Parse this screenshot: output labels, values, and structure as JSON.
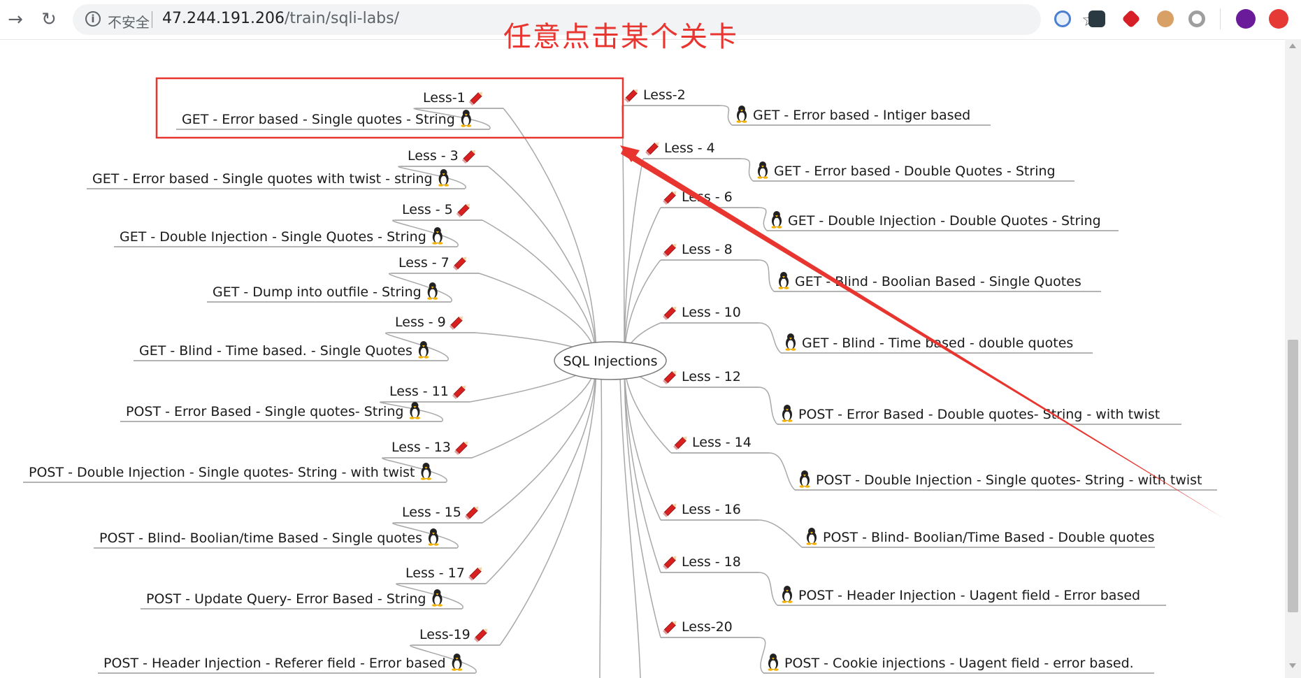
{
  "browser": {
    "security_label": "不安全",
    "url_host": "47.244.191.206",
    "url_path": "/train/sqli-labs/"
  },
  "annotation": "任意点击某个关卡",
  "mindmap": {
    "center": "SQL Injections",
    "left": [
      {
        "less": "Less-1",
        "title": "GET - Error based - Single quotes - String"
      },
      {
        "less": "Less - 3",
        "title": "GET - Error based - Single quotes with twist - string"
      },
      {
        "less": "Less - 5",
        "title": "GET - Double Injection - Single Quotes - String"
      },
      {
        "less": "Less - 7",
        "title": "GET - Dump into outfile - String"
      },
      {
        "less": "Less - 9",
        "title": "GET - Blind - Time based. -  Single Quotes"
      },
      {
        "less": "Less - 11",
        "title": "POST - Error Based - Single quotes- String"
      },
      {
        "less": "Less - 13",
        "title": "POST - Double Injection - Single quotes- String - with twist"
      },
      {
        "less": "Less - 15",
        "title": "POST - Blind- Boolian/time Based - Single quotes"
      },
      {
        "less": "Less - 17",
        "title": "POST - Update Query- Error Based - String"
      },
      {
        "less": "Less-19",
        "title": "POST - Header Injection - Referer field - Error based"
      }
    ],
    "right": [
      {
        "less": "Less-2",
        "title": "GET - Error based - Intiger based"
      },
      {
        "less": "Less - 4",
        "title": "GET - Error based - Double Quotes - String"
      },
      {
        "less": "Less - 6",
        "title": "GET - Double Injection - Double Quotes - String"
      },
      {
        "less": "Less - 8",
        "title": "GET - Blind - Boolian Based - Single Quotes"
      },
      {
        "less": "Less - 10",
        "title": "GET - Blind - Time based - double quotes"
      },
      {
        "less": "Less - 12",
        "title": "POST - Error Based - Double quotes- String - with twist"
      },
      {
        "less": "Less - 14",
        "title": "POST - Double Injection - Single quotes- String - with twist"
      },
      {
        "less": "Less - 16",
        "title": "POST - Blind- Boolian/Time Based - Double quotes"
      },
      {
        "less": "Less - 18",
        "title": "POST - Header Injection - Uagent field - Error based"
      },
      {
        "less": "Less-20",
        "title": "POST - Cookie injections - Uagent field - error based."
      }
    ]
  },
  "colors": {
    "annotation": "#e8352f",
    "connector": "#a8a8a8",
    "underline": "#9a9a9a",
    "pencil_red": "#d92020"
  },
  "icons": {
    "level_marker": "pencil-icon",
    "title_marker": "penguin-icon"
  }
}
